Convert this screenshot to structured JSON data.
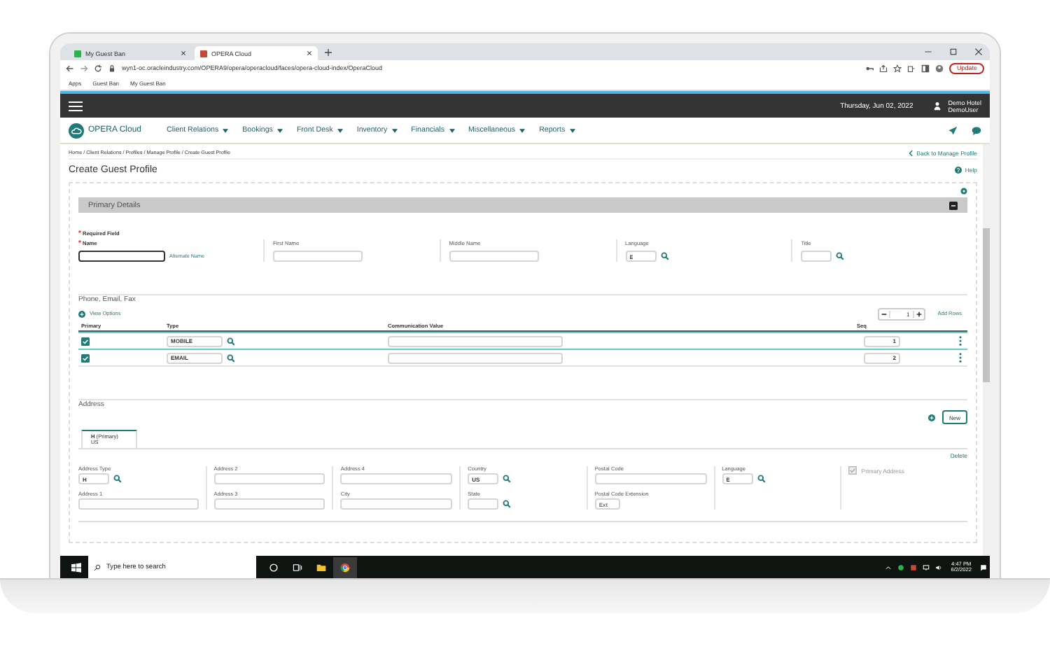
{
  "browser": {
    "tabs": [
      {
        "title": "My Guest Ban",
        "selected": false
      },
      {
        "title": "OPERA Cloud",
        "selected": true
      }
    ],
    "url": "wyn1-oc.oracleindustry.com/OPERA9/opera/operacloud/faces/opera-cloud-index/OperaCloud",
    "update_button": "Update",
    "bookmarks": [
      "Apps",
      "Guest Ban",
      "My Guest Ban"
    ]
  },
  "header": {
    "date": "Thursday, Jun 02, 2022",
    "hotel": "Demo Hotel",
    "user": "DemoUser"
  },
  "nav": {
    "brand": "OPERA Cloud",
    "menus": [
      "Client Relations",
      "Bookings",
      "Front Desk",
      "Inventory",
      "Financials",
      "Miscellaneous",
      "Reports"
    ]
  },
  "breadcrumb": "Home / Client Relations / Profiles / Manage Profile / Create Guest Profile",
  "back_link": "Back to Manage Profile",
  "page_title": "Create Guest Profile",
  "help": "Help",
  "primary_details": {
    "title": "Primary Details",
    "required_note": "Required Field",
    "required_mark": "*",
    "alternate_name": "Alternate Name",
    "fields": [
      {
        "label": "Name",
        "kind": "text",
        "required": true,
        "focused": true
      },
      {
        "label": "First Name",
        "kind": "text",
        "required": false,
        "focused": false
      },
      {
        "label": "Middle Name",
        "kind": "text",
        "required": false,
        "focused": false
      },
      {
        "label": "Language",
        "kind": "lookup",
        "value": "E",
        "required": false,
        "focused": false
      },
      {
        "label": "Title",
        "kind": "lookup",
        "required": false,
        "focused": false
      }
    ]
  },
  "phone": {
    "title": "Phone, Email, Fax",
    "view_options": "View Options",
    "stepper": "1",
    "add_rows": "Add Rows",
    "columns": [
      "Primary",
      "Type",
      "Communication Value",
      "Seq"
    ],
    "rows": [
      {
        "primary": true,
        "type": "MOBILE",
        "seq": "1",
        "selected": true
      },
      {
        "primary": true,
        "type": "EMAIL",
        "seq": "2",
        "selected": false
      }
    ]
  },
  "address": {
    "title": "Address",
    "new_button": "New",
    "tab": {
      "title": "H",
      "note": "(Primary)",
      "subtitle": "US",
      "selected": true
    },
    "delete": "Delete",
    "columns": [
      [
        {
          "label": "Address Type",
          "kind": "lookup",
          "value": "H"
        },
        {
          "label": "Address 1",
          "kind": "text"
        }
      ],
      [
        {
          "label": "Address 2",
          "kind": "text"
        },
        {
          "label": "Address 3",
          "kind": "text"
        }
      ],
      [
        {
          "label": "Address 4",
          "kind": "text"
        },
        {
          "label": "City",
          "kind": "text"
        }
      ],
      [
        {
          "label": "Country",
          "kind": "lookup",
          "value": "US"
        },
        {
          "label": "State",
          "kind": "lookup"
        }
      ],
      [
        {
          "label": "Postal Code",
          "kind": "text"
        },
        {
          "label": "Postal Code Extension",
          "kind": "short",
          "placeholder": "Ext"
        }
      ],
      [
        {
          "label": "Language",
          "kind": "lookup",
          "value": "E"
        }
      ]
    ],
    "primary_address": {
      "label": "Primary Address",
      "checked": true,
      "disabled": true
    }
  },
  "taskbar": {
    "search_placeholder": "Type here to search",
    "time": "4:47 PM",
    "date": "6/2/2022"
  }
}
